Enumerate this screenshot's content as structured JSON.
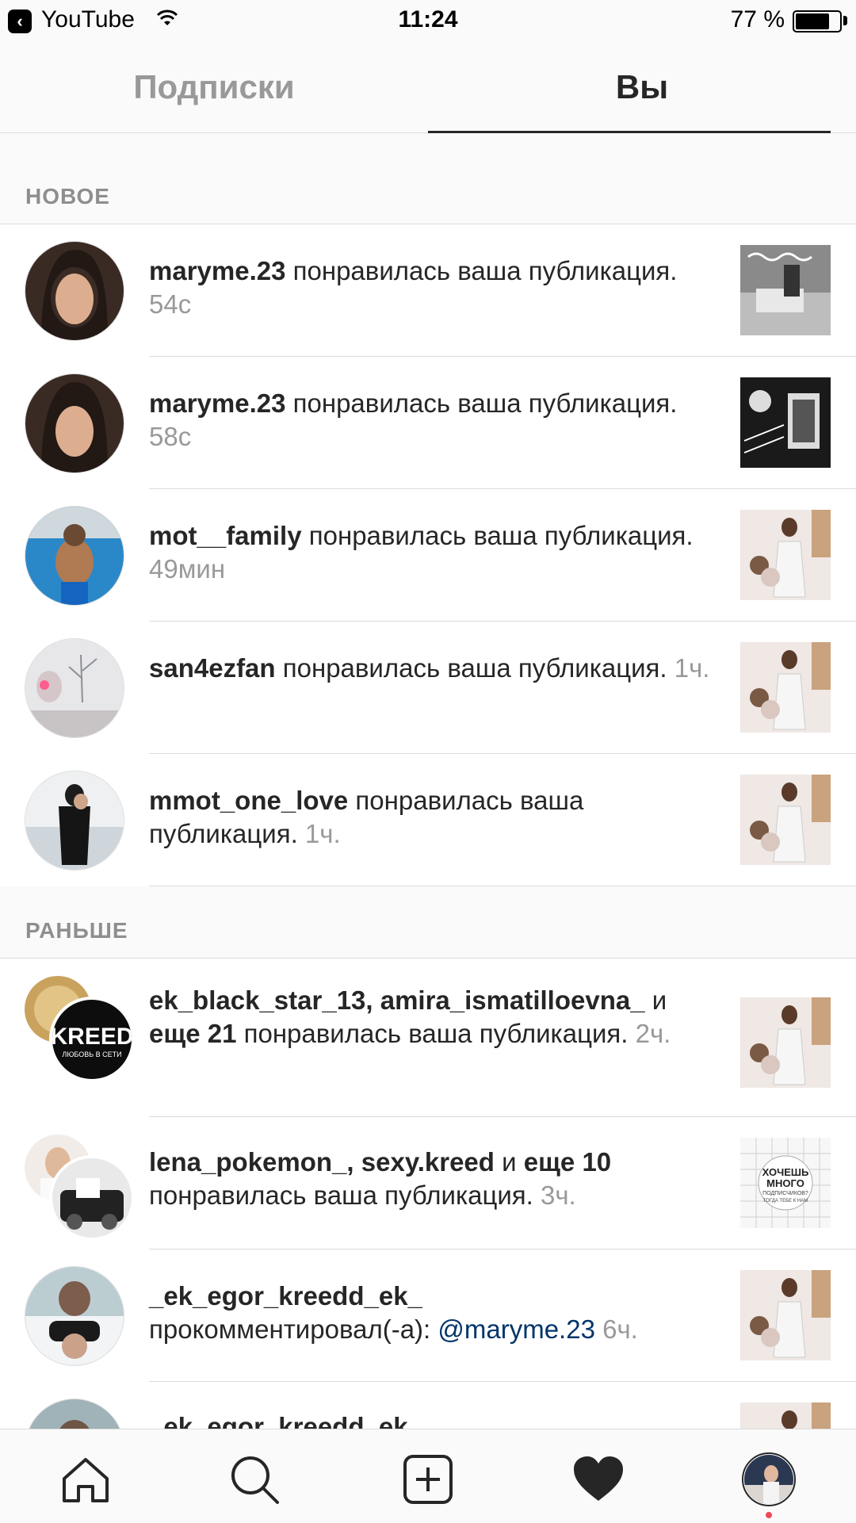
{
  "status_bar": {
    "back_app": "YouTube",
    "time": "11:24",
    "battery": "77 %",
    "battery_level": 0.77
  },
  "tabs": {
    "following": "Подписки",
    "you": "Вы",
    "active": "you"
  },
  "sections": {
    "new_title": "НОВОЕ",
    "earlier_title": "РАНЬШЕ"
  },
  "new_items": [
    {
      "user": "maryme.23",
      "action": " понравилась ваша публикация.",
      "time": "54с",
      "avatar_icon": "avatar-photo",
      "thumb_icon": "post-thumbnail"
    },
    {
      "user": "maryme.23",
      "action": " понравилась ваша публикация.",
      "time": "58с",
      "avatar_icon": "avatar-photo",
      "thumb_icon": "post-thumbnail"
    },
    {
      "user": "mot__family",
      "action": " понравилась ваша публикация.",
      "time": "49мин",
      "avatar_icon": "avatar-photo",
      "thumb_icon": "post-thumbnail"
    },
    {
      "user": "san4ezfan",
      "action": " понравилась ваша публикация.",
      "time": "1ч.",
      "avatar_icon": "avatar-photo",
      "thumb_icon": "post-thumbnail"
    },
    {
      "user": "mmot_one_love",
      "action": " понравилась ваша публикация.",
      "time": "1ч.",
      "avatar_icon": "avatar-photo",
      "thumb_icon": "post-thumbnail"
    }
  ],
  "earlier_items": [
    {
      "users": "ek_black_star_13, amira_ismatilloevna_",
      "joiner": " и ",
      "more": "еще 21",
      "action": " понравилась ваша публикация.",
      "time": "2ч."
    },
    {
      "users": "lena_pokemon_, sexy.kreed",
      "joiner": " и ",
      "more": "еще 10",
      "action": " понравилась ваша публикация.",
      "time": "3ч."
    },
    {
      "users": "_ek_egor_kreedd_ek_",
      "action": "прокомментировал(-а): ",
      "mention": "@maryme.23",
      "time": "6ч."
    },
    {
      "users": "_ek_egor_kreedd_ek_"
    }
  ],
  "thumb_texts": {
    "kreed_logo": "KREED",
    "kreed_sub": "ЛЮБОВЬ В СЕТИ",
    "promo_line1": "ХОЧЕШЬ",
    "promo_line2": "МНОГО",
    "promo_line3": "ПОДПИСЧИКОВ?",
    "promo_line4": "ТОГДА ТЕБЕ К НАМ"
  },
  "bottom_nav": [
    "home-icon",
    "search-icon",
    "add-post-icon",
    "activity-heart-icon",
    "profile-avatar"
  ],
  "colors": {
    "mention": "#003569",
    "secondary": "#999999",
    "notification_dot": "#ed4956"
  }
}
